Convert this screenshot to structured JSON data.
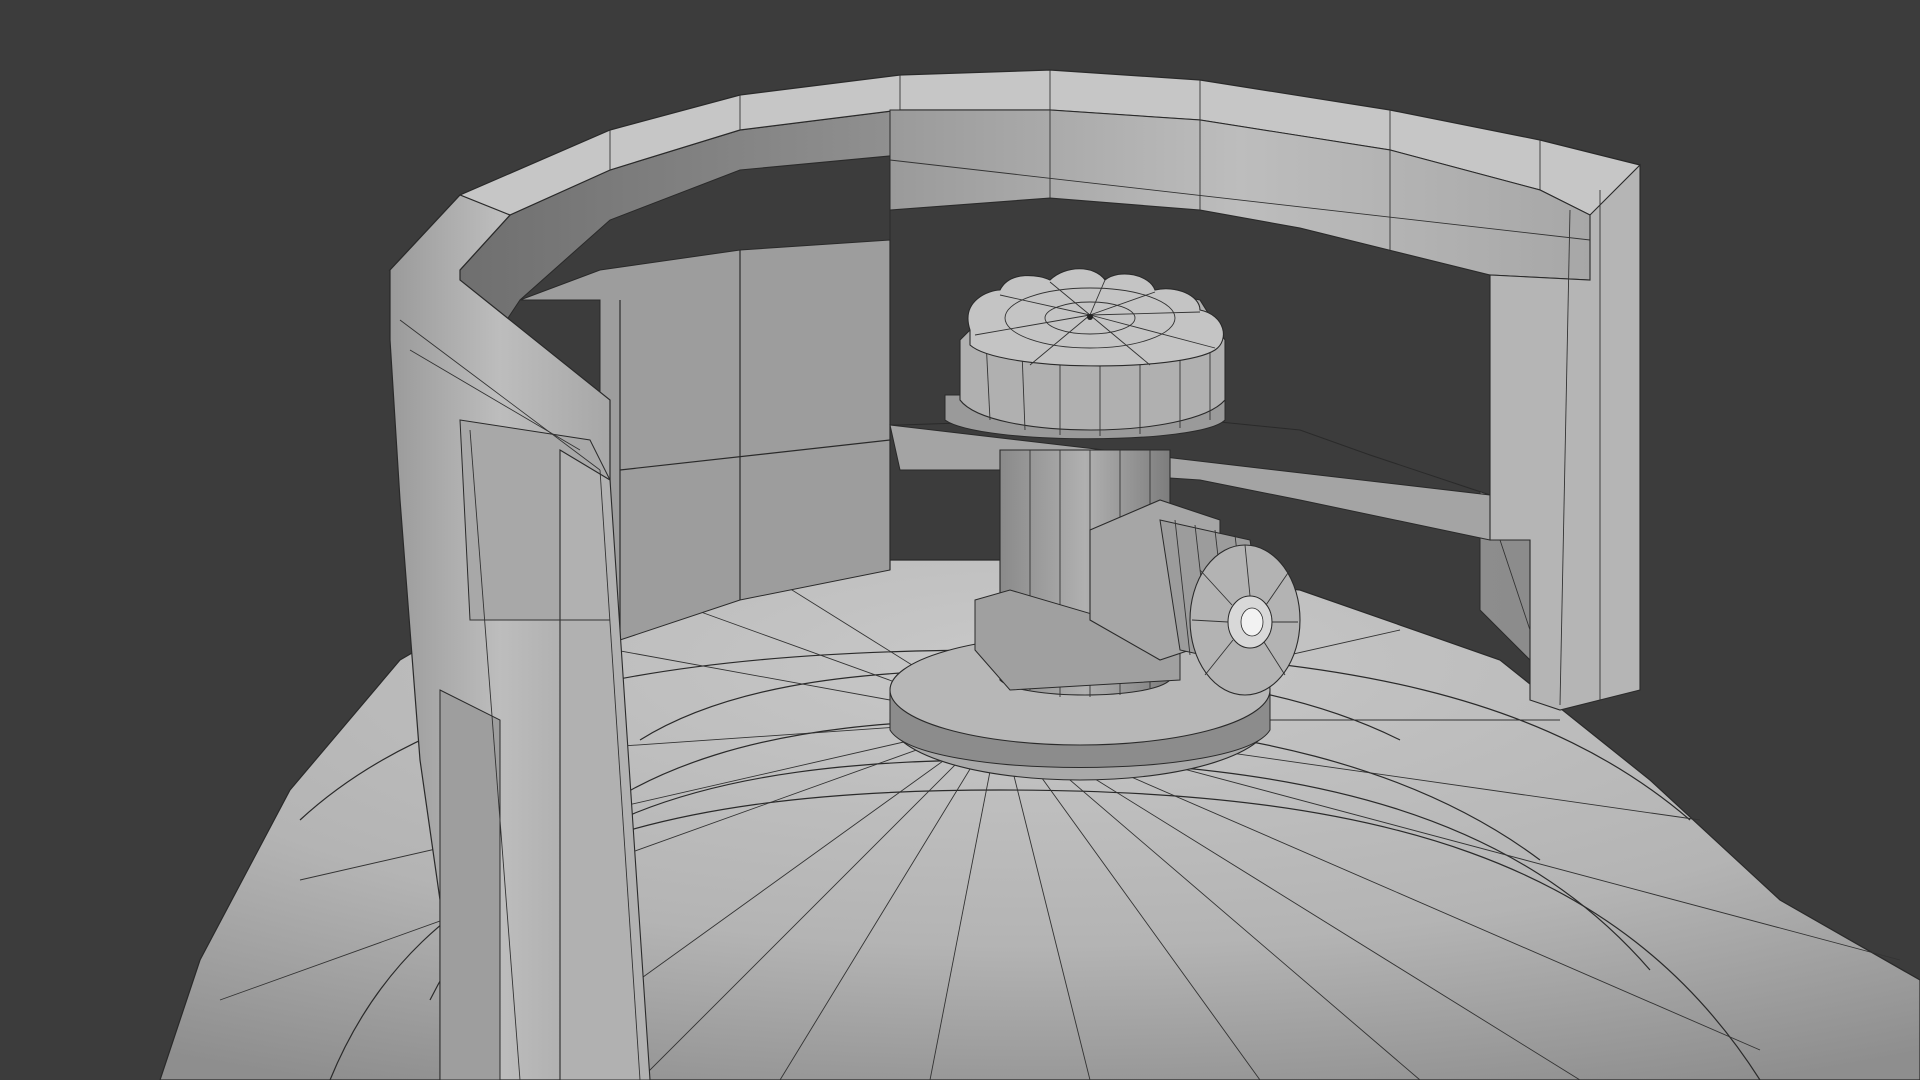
{
  "viewport": {
    "background_color": "#3c3c3c",
    "object": "gas-cylinder",
    "shading": "solid-with-wireframe",
    "surface_color": "#b9b9b9",
    "wire_color": "#2a2a2a"
  }
}
